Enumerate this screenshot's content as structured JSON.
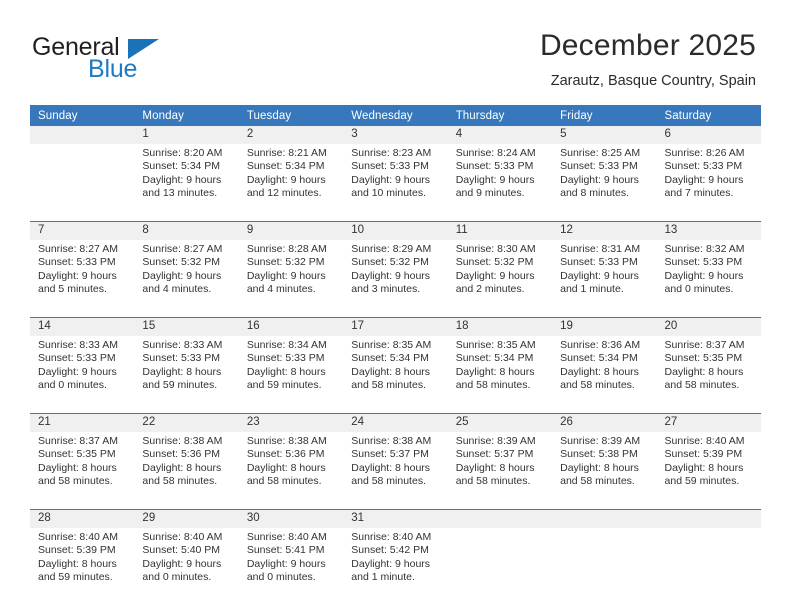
{
  "brand": {
    "name_top": "General",
    "name_bottom": "Blue",
    "triangle_icon": "triangle-icon",
    "color_dark": "#231f20",
    "color_blue": "#1f7bc1"
  },
  "header": {
    "title": "December 2025",
    "location": "Zarautz, Basque Country, Spain"
  },
  "theme": {
    "header_blue": "#3778bc",
    "daynum_bg": "#f0f0f0",
    "text": "#333333"
  },
  "calendar": {
    "weekday_headers": [
      "Sunday",
      "Monday",
      "Tuesday",
      "Wednesday",
      "Thursday",
      "Friday",
      "Saturday"
    ],
    "weeks": [
      [
        {
          "day": "",
          "sunrise": "",
          "sunset": "",
          "daylight": ""
        },
        {
          "day": "1",
          "sunrise": "Sunrise: 8:20 AM",
          "sunset": "Sunset: 5:34 PM",
          "daylight": "Daylight: 9 hours and 13 minutes."
        },
        {
          "day": "2",
          "sunrise": "Sunrise: 8:21 AM",
          "sunset": "Sunset: 5:34 PM",
          "daylight": "Daylight: 9 hours and 12 minutes."
        },
        {
          "day": "3",
          "sunrise": "Sunrise: 8:23 AM",
          "sunset": "Sunset: 5:33 PM",
          "daylight": "Daylight: 9 hours and 10 minutes."
        },
        {
          "day": "4",
          "sunrise": "Sunrise: 8:24 AM",
          "sunset": "Sunset: 5:33 PM",
          "daylight": "Daylight: 9 hours and 9 minutes."
        },
        {
          "day": "5",
          "sunrise": "Sunrise: 8:25 AM",
          "sunset": "Sunset: 5:33 PM",
          "daylight": "Daylight: 9 hours and 8 minutes."
        },
        {
          "day": "6",
          "sunrise": "Sunrise: 8:26 AM",
          "sunset": "Sunset: 5:33 PM",
          "daylight": "Daylight: 9 hours and 7 minutes."
        }
      ],
      [
        {
          "day": "7",
          "sunrise": "Sunrise: 8:27 AM",
          "sunset": "Sunset: 5:33 PM",
          "daylight": "Daylight: 9 hours and 5 minutes."
        },
        {
          "day": "8",
          "sunrise": "Sunrise: 8:27 AM",
          "sunset": "Sunset: 5:32 PM",
          "daylight": "Daylight: 9 hours and 4 minutes."
        },
        {
          "day": "9",
          "sunrise": "Sunrise: 8:28 AM",
          "sunset": "Sunset: 5:32 PM",
          "daylight": "Daylight: 9 hours and 4 minutes."
        },
        {
          "day": "10",
          "sunrise": "Sunrise: 8:29 AM",
          "sunset": "Sunset: 5:32 PM",
          "daylight": "Daylight: 9 hours and 3 minutes."
        },
        {
          "day": "11",
          "sunrise": "Sunrise: 8:30 AM",
          "sunset": "Sunset: 5:32 PM",
          "daylight": "Daylight: 9 hours and 2 minutes."
        },
        {
          "day": "12",
          "sunrise": "Sunrise: 8:31 AM",
          "sunset": "Sunset: 5:33 PM",
          "daylight": "Daylight: 9 hours and 1 minute."
        },
        {
          "day": "13",
          "sunrise": "Sunrise: 8:32 AM",
          "sunset": "Sunset: 5:33 PM",
          "daylight": "Daylight: 9 hours and 0 minutes."
        }
      ],
      [
        {
          "day": "14",
          "sunrise": "Sunrise: 8:33 AM",
          "sunset": "Sunset: 5:33 PM",
          "daylight": "Daylight: 9 hours and 0 minutes."
        },
        {
          "day": "15",
          "sunrise": "Sunrise: 8:33 AM",
          "sunset": "Sunset: 5:33 PM",
          "daylight": "Daylight: 8 hours and 59 minutes."
        },
        {
          "day": "16",
          "sunrise": "Sunrise: 8:34 AM",
          "sunset": "Sunset: 5:33 PM",
          "daylight": "Daylight: 8 hours and 59 minutes."
        },
        {
          "day": "17",
          "sunrise": "Sunrise: 8:35 AM",
          "sunset": "Sunset: 5:34 PM",
          "daylight": "Daylight: 8 hours and 58 minutes."
        },
        {
          "day": "18",
          "sunrise": "Sunrise: 8:35 AM",
          "sunset": "Sunset: 5:34 PM",
          "daylight": "Daylight: 8 hours and 58 minutes."
        },
        {
          "day": "19",
          "sunrise": "Sunrise: 8:36 AM",
          "sunset": "Sunset: 5:34 PM",
          "daylight": "Daylight: 8 hours and 58 minutes."
        },
        {
          "day": "20",
          "sunrise": "Sunrise: 8:37 AM",
          "sunset": "Sunset: 5:35 PM",
          "daylight": "Daylight: 8 hours and 58 minutes."
        }
      ],
      [
        {
          "day": "21",
          "sunrise": "Sunrise: 8:37 AM",
          "sunset": "Sunset: 5:35 PM",
          "daylight": "Daylight: 8 hours and 58 minutes."
        },
        {
          "day": "22",
          "sunrise": "Sunrise: 8:38 AM",
          "sunset": "Sunset: 5:36 PM",
          "daylight": "Daylight: 8 hours and 58 minutes."
        },
        {
          "day": "23",
          "sunrise": "Sunrise: 8:38 AM",
          "sunset": "Sunset: 5:36 PM",
          "daylight": "Daylight: 8 hours and 58 minutes."
        },
        {
          "day": "24",
          "sunrise": "Sunrise: 8:38 AM",
          "sunset": "Sunset: 5:37 PM",
          "daylight": "Daylight: 8 hours and 58 minutes."
        },
        {
          "day": "25",
          "sunrise": "Sunrise: 8:39 AM",
          "sunset": "Sunset: 5:37 PM",
          "daylight": "Daylight: 8 hours and 58 minutes."
        },
        {
          "day": "26",
          "sunrise": "Sunrise: 8:39 AM",
          "sunset": "Sunset: 5:38 PM",
          "daylight": "Daylight: 8 hours and 58 minutes."
        },
        {
          "day": "27",
          "sunrise": "Sunrise: 8:40 AM",
          "sunset": "Sunset: 5:39 PM",
          "daylight": "Daylight: 8 hours and 59 minutes."
        }
      ],
      [
        {
          "day": "28",
          "sunrise": "Sunrise: 8:40 AM",
          "sunset": "Sunset: 5:39 PM",
          "daylight": "Daylight: 8 hours and 59 minutes."
        },
        {
          "day": "29",
          "sunrise": "Sunrise: 8:40 AM",
          "sunset": "Sunset: 5:40 PM",
          "daylight": "Daylight: 9 hours and 0 minutes."
        },
        {
          "day": "30",
          "sunrise": "Sunrise: 8:40 AM",
          "sunset": "Sunset: 5:41 PM",
          "daylight": "Daylight: 9 hours and 0 minutes."
        },
        {
          "day": "31",
          "sunrise": "Sunrise: 8:40 AM",
          "sunset": "Sunset: 5:42 PM",
          "daylight": "Daylight: 9 hours and 1 minute."
        },
        {
          "day": "",
          "sunrise": "",
          "sunset": "",
          "daylight": ""
        },
        {
          "day": "",
          "sunrise": "",
          "sunset": "",
          "daylight": ""
        },
        {
          "day": "",
          "sunrise": "",
          "sunset": "",
          "daylight": ""
        }
      ]
    ]
  }
}
